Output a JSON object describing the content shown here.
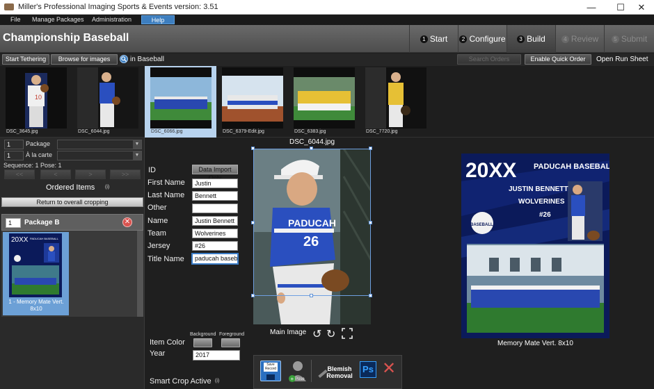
{
  "window": {
    "title": "Miller's Professional Imaging Sports & Events version: 3.51",
    "minimize": "—",
    "maximize": "☐",
    "close": "✕"
  },
  "menu": {
    "file": "File",
    "manage_packages": "Manage Packages",
    "administration": "Administration",
    "help": "Help"
  },
  "header": {
    "event_title": "Championship Baseball",
    "steps": [
      {
        "num": "1",
        "label": "Start"
      },
      {
        "num": "2",
        "label": "Configure"
      },
      {
        "num": "3",
        "label": "Build"
      },
      {
        "num": "4",
        "label": "Review"
      },
      {
        "num": "5",
        "label": "Submit"
      }
    ]
  },
  "toolbar": {
    "start_tethering": "Start Tethering",
    "browse_images": "Browse for images",
    "search_scope": "in Baseball",
    "search_orders": "Search Orders",
    "quick_order": "Enable Quick Order",
    "open_run_sheet": "Open Run Sheet"
  },
  "filmstrip": [
    "DSC_3645.jpg",
    "DSC_6044.jpg",
    "DSC_6066.jpg",
    "DSC_6379-Edit.jpg",
    "DSC_6383.jpg",
    "DSC_7720.jpg"
  ],
  "left": {
    "package_qty": "1",
    "package_label": "Package",
    "alacarte_qty": "1",
    "alacarte_label": "À la carte",
    "sequence": "Sequence: 1  Pose: 1",
    "nav_first": "<<",
    "nav_prev": "<",
    "nav_next": ">",
    "nav_last": ">>",
    "ordered_items": "Ordered Items",
    "info": "(i)",
    "return_cropping": "Return to overall cropping",
    "package_b_qty": "1",
    "package_b": "Package B",
    "item_caption": "1 - Memory Mate Vert. 8x10",
    "item_thumb_20xx": "20XX",
    "item_thumb_team": "PADUCAH BASEBALL"
  },
  "center": {
    "image_name": "DSC_6044.jpg",
    "id_label": "ID",
    "data_import": "Data Import Only",
    "first_name_label": "First Name",
    "first_name": "Justin",
    "last_name_label": "Last Name",
    "last_name": "Bennett",
    "other_label": "Other",
    "other": "",
    "name_label": "Name",
    "name": "Justin Bennett",
    "team_label": "Team",
    "team": "Wolverines",
    "jersey_label": "Jersey",
    "jersey": "#26",
    "title_name_label": "Title Name",
    "title_name": "paducah baseba",
    "main_image_label": "Main Image",
    "item_color_label": "Item Color",
    "background_label": "Background",
    "foreground_label": "Foreground",
    "year_label": "Year",
    "year": "2017",
    "smart_crop": "Smart Crop Active",
    "smart_crop_info": "(i)",
    "save_record": "Save Record",
    "pose": "Pose",
    "blemish_removal": "Blemish Removal",
    "ps": "Ps",
    "jersey_number": "26"
  },
  "preview": {
    "year": "20XX",
    "team_title": "PADUCAH BASEBALL",
    "player_name": "JUSTIN BENNETT",
    "team_name": "WOLVERINES",
    "number": "#26",
    "badge": "BASEBALL",
    "caption": "Memory Mate Vert. 8x10"
  },
  "colors": {
    "accent": "#3d7ebf",
    "preview_bg": "#0b1a5a",
    "close_red": "#d9534f"
  }
}
